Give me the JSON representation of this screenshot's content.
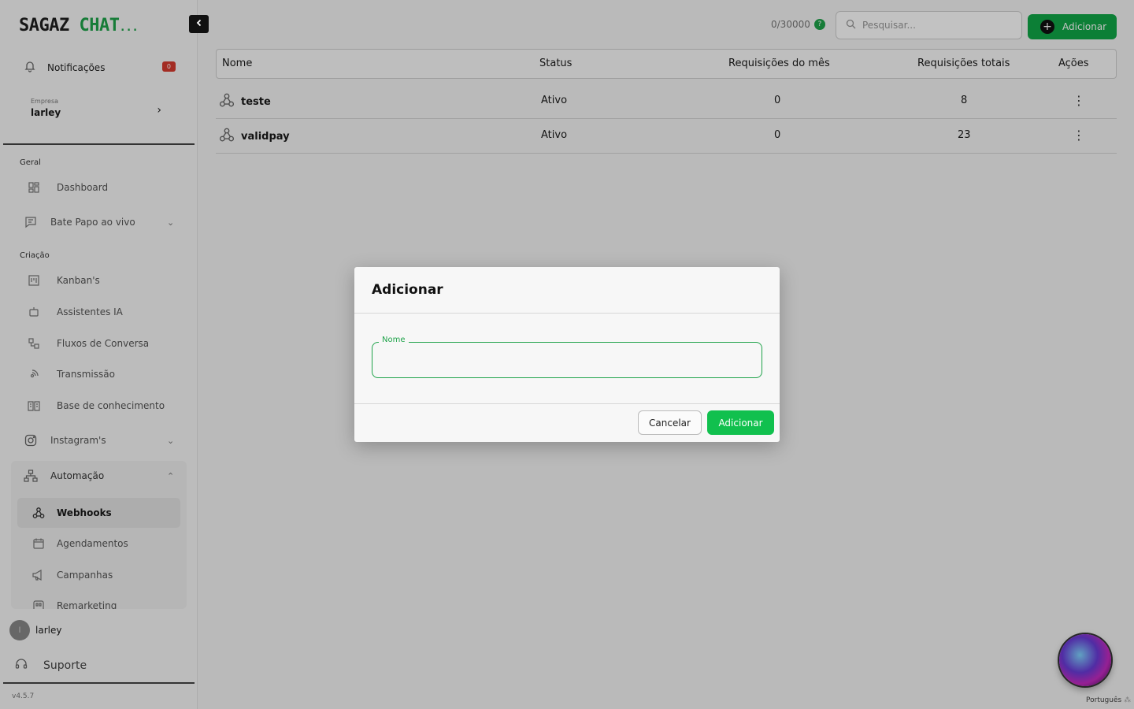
{
  "app": {
    "logo_part1": "SAGAZ",
    "logo_part2": " CHAT",
    "logo_tail": "...",
    "version": "v4.5.7",
    "language": "Português"
  },
  "sidebar": {
    "notifications_label": "Notificações",
    "notifications_count": "0",
    "company_caption": "Empresa",
    "company_name": "larley",
    "section_general": "Geral",
    "section_creation": "Criação",
    "items": {
      "dashboard": "Dashboard",
      "live_chat": "Bate Papo ao vivo",
      "kanbans": "Kanban's",
      "ai_assistants": "Assistentes IA",
      "flows": "Fluxos de Conversa",
      "broadcast": "Transmissão",
      "knowledge": "Base de conhecimento",
      "instagram": "Instagram's",
      "automation": "Automação",
      "webhooks": "Webhooks",
      "schedules": "Agendamentos",
      "campaigns": "Campanhas",
      "remarketing": "Remarketing"
    },
    "user_name": "larley",
    "user_initial": "l",
    "support_label": "Suporte"
  },
  "header": {
    "counter": "0/30000",
    "help": "?",
    "search_placeholder": "Pesquisar...",
    "add_label": "Adicionar"
  },
  "table": {
    "columns": {
      "name": "Nome",
      "status": "Status",
      "monthly": "Requisições do mês",
      "total": "Requisições totais",
      "actions": "Ações"
    },
    "rows": [
      {
        "name": "teste",
        "status": "Ativo",
        "monthly": "0",
        "total": "8"
      },
      {
        "name": "validpay",
        "status": "Ativo",
        "monthly": "0",
        "total": "23"
      }
    ]
  },
  "modal": {
    "title": "Adicionar",
    "field_label": "Nome",
    "field_value": "",
    "cancel_label": "Cancelar",
    "submit_label": "Adicionar"
  },
  "colors": {
    "accent": "#11a848",
    "badge": "#d63a2f"
  }
}
